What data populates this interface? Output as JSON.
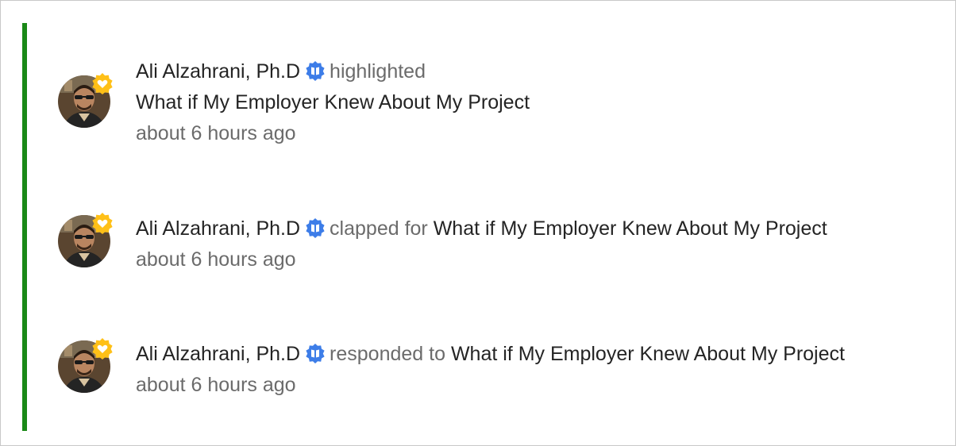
{
  "colors": {
    "accent": "#1a8917",
    "verified": "#3d7de8",
    "badge": "#ffc017",
    "text_primary": "#242424",
    "text_secondary": "#6b6b6b"
  },
  "notifications": [
    {
      "author": "Ali Alzahrani, Ph.D",
      "verified_icon": "verified-badge-icon",
      "action": "highlighted",
      "story": "What if My Employer Knew About My Project",
      "time": "about 6 hours ago",
      "avatar_badge_icon": "heart-badge-icon"
    },
    {
      "author": "Ali Alzahrani, Ph.D",
      "verified_icon": "verified-badge-icon",
      "action": "clapped for",
      "story": "What if My Employer Knew About My Project",
      "time": "about 6 hours ago",
      "avatar_badge_icon": "heart-badge-icon"
    },
    {
      "author": "Ali Alzahrani, Ph.D",
      "verified_icon": "verified-badge-icon",
      "action": "responded to",
      "story": "What if My Employer Knew About My Project",
      "time": "about 6 hours ago",
      "avatar_badge_icon": "heart-badge-icon"
    }
  ]
}
